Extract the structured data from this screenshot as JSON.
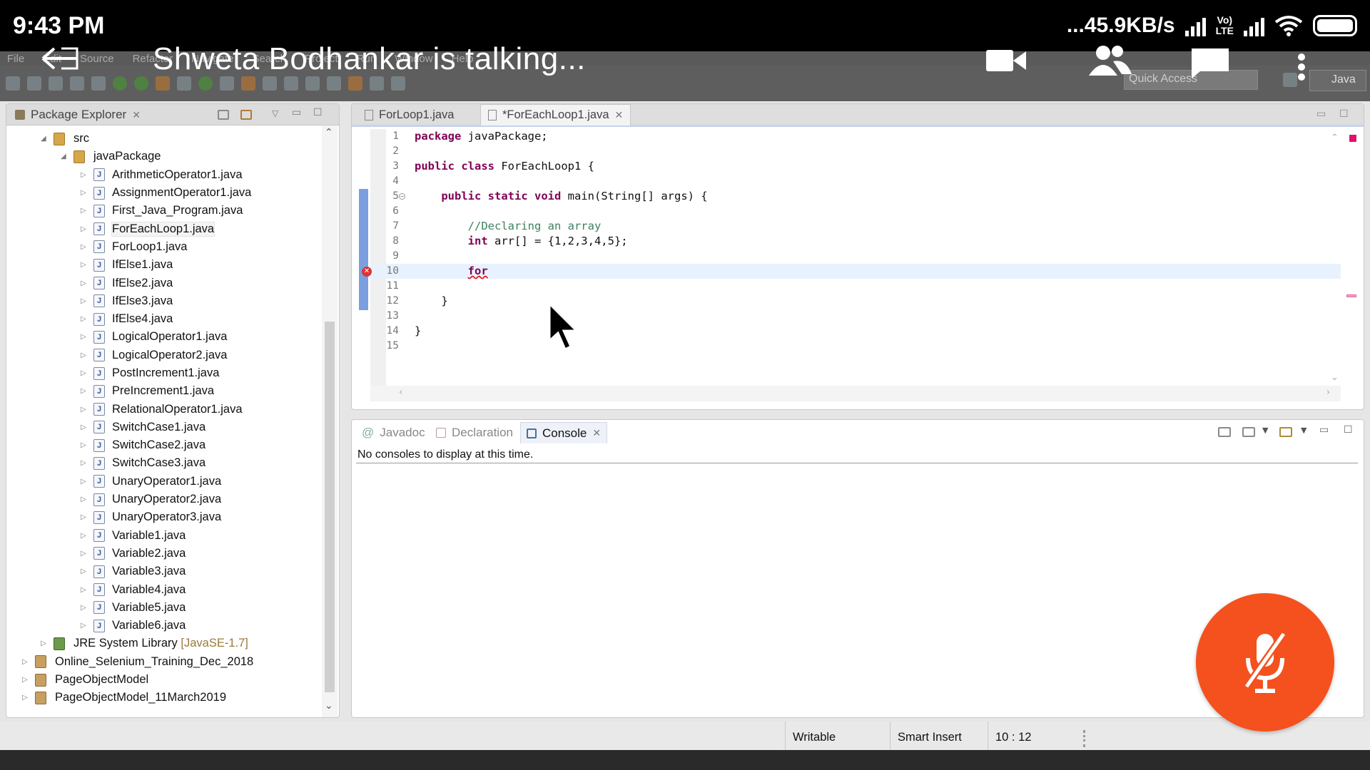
{
  "status_bar": {
    "time": "9:43 PM",
    "network_speed": "...45.9KB/s",
    "volte_label_top": "Vo)",
    "volte_label_bottom": "LTE"
  },
  "meeting": {
    "title": "Shweta Bodhankar is talking..."
  },
  "menubar": {
    "items": [
      "File",
      "Edit",
      "Source",
      "Refactor",
      "Navigate",
      "Search",
      "Project",
      "Run",
      "Window",
      "Help"
    ]
  },
  "toolbar": {
    "quick_access_placeholder": "Quick Access",
    "perspective_label": "Java"
  },
  "package_explorer": {
    "title": "Package Explorer",
    "src_label": "src",
    "package_label": "javaPackage",
    "files": [
      "ArithmeticOperator1.java",
      "AssignmentOperator1.java",
      "First_Java_Program.java",
      "ForEachLoop1.java",
      "ForLoop1.java",
      "IfElse1.java",
      "IfElse2.java",
      "IfElse3.java",
      "IfElse4.java",
      "LogicalOperator1.java",
      "LogicalOperator2.java",
      "PostIncrement1.java",
      "PreIncrement1.java",
      "RelationalOperator1.java",
      "SwitchCase1.java",
      "SwitchCase2.java",
      "SwitchCase3.java",
      "UnaryOperator1.java",
      "UnaryOperator2.java",
      "UnaryOperator3.java",
      "Variable1.java",
      "Variable2.java",
      "Variable3.java",
      "Variable4.java",
      "Variable5.java",
      "Variable6.java"
    ],
    "selected_file": "ForEachLoop1.java",
    "jre_label": "JRE System Library",
    "jre_version": "[JavaSE-1.7]",
    "projects": [
      "Online_Selenium_Training_Dec_2018",
      "PageObjectModel",
      "PageObjectModel_11March2019"
    ]
  },
  "editor": {
    "tabs": [
      {
        "label": "ForLoop1.java",
        "active": false
      },
      {
        "label": "*ForEachLoop1.java",
        "active": true
      }
    ],
    "lines": [
      {
        "n": "1",
        "tokens": [
          {
            "t": "package",
            "c": "kw"
          },
          {
            "t": " javaPackage;",
            "c": ""
          }
        ]
      },
      {
        "n": "2",
        "tokens": []
      },
      {
        "n": "3",
        "tokens": [
          {
            "t": "public",
            "c": "kw"
          },
          {
            "t": " ",
            "c": ""
          },
          {
            "t": "class",
            "c": "kw"
          },
          {
            "t": " ForEachLoop1 {",
            "c": ""
          }
        ]
      },
      {
        "n": "4",
        "tokens": []
      },
      {
        "n": "5",
        "tokens": [
          {
            "t": "    ",
            "c": ""
          },
          {
            "t": "public",
            "c": "kw"
          },
          {
            "t": " ",
            "c": ""
          },
          {
            "t": "static",
            "c": "kw"
          },
          {
            "t": " ",
            "c": ""
          },
          {
            "t": "void",
            "c": "kw"
          },
          {
            "t": " main(String[] args) {",
            "c": ""
          }
        ]
      },
      {
        "n": "6",
        "tokens": []
      },
      {
        "n": "7",
        "tokens": [
          {
            "t": "        ",
            "c": ""
          },
          {
            "t": "//Declaring an array",
            "c": "cm"
          }
        ]
      },
      {
        "n": "8",
        "tokens": [
          {
            "t": "        ",
            "c": ""
          },
          {
            "t": "int",
            "c": "kw"
          },
          {
            "t": " arr[] = {1,2,3,4,5};",
            "c": ""
          }
        ]
      },
      {
        "n": "9",
        "tokens": []
      },
      {
        "n": "10",
        "tokens": [
          {
            "t": "        ",
            "c": ""
          },
          {
            "t": "for",
            "c": "err-word"
          }
        ]
      },
      {
        "n": "11",
        "tokens": []
      },
      {
        "n": "12",
        "tokens": [
          {
            "t": "    }",
            "c": ""
          }
        ]
      },
      {
        "n": "13",
        "tokens": []
      },
      {
        "n": "14",
        "tokens": [
          {
            "t": "}",
            "c": ""
          }
        ]
      },
      {
        "n": "15",
        "tokens": []
      }
    ]
  },
  "console": {
    "tabs": [
      {
        "label": "Javadoc",
        "active": false
      },
      {
        "label": "Declaration",
        "active": false
      },
      {
        "label": "Console",
        "active": true
      }
    ],
    "message": "No consoles to display at this time."
  },
  "ide_status": {
    "writable": "Writable",
    "insert_mode": "Smart Insert",
    "position": "10 : 12"
  },
  "colors": {
    "mic_fab": "#f4511e",
    "keyword": "#7f0055",
    "comment": "#3f7f5f"
  }
}
